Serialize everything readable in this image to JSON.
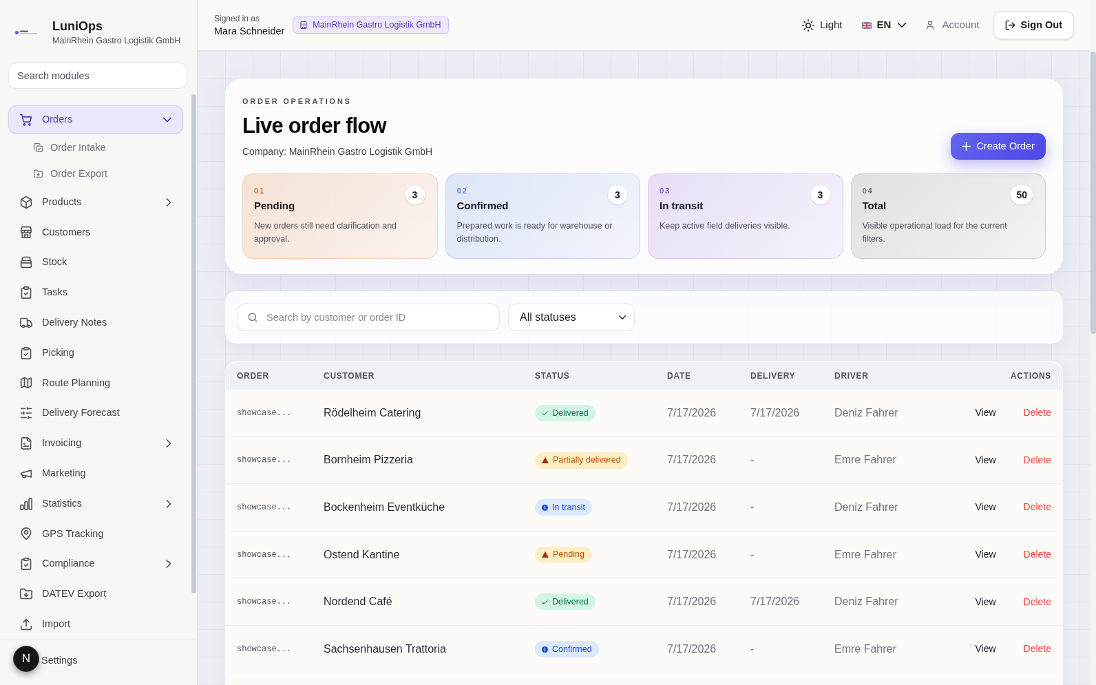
{
  "sidebar": {
    "brand": "LuniOps",
    "company": "MainRhein Gastro Logistik GmbH",
    "search": {
      "placeholder": "Search modules"
    },
    "items": [
      {
        "label": "Orders",
        "kind": "group",
        "selected": true,
        "expanded": true,
        "children": [
          {
            "label": "Order Intake",
            "selected": false
          },
          {
            "label": "Order Export",
            "selected": false
          }
        ]
      },
      {
        "label": "Products",
        "kind": "group",
        "selected": false,
        "expanded": false
      },
      {
        "label": "Customers",
        "kind": "link",
        "selected": false
      },
      {
        "label": "Stock",
        "kind": "link",
        "selected": false
      },
      {
        "label": "Tasks",
        "kind": "link",
        "selected": false
      },
      {
        "label": "Delivery Notes",
        "kind": "link",
        "selected": false
      },
      {
        "label": "Picking",
        "kind": "link",
        "selected": false
      },
      {
        "label": "Route Planning",
        "kind": "link",
        "selected": false
      },
      {
        "label": "Delivery Forecast",
        "kind": "link",
        "selected": false
      },
      {
        "label": "Invoicing",
        "kind": "group",
        "selected": false,
        "expanded": false
      },
      {
        "label": "Marketing",
        "kind": "link",
        "selected": false
      },
      {
        "label": "Statistics",
        "kind": "group",
        "selected": false,
        "expanded": false
      },
      {
        "label": "GPS Tracking",
        "kind": "link",
        "selected": false
      },
      {
        "label": "Compliance",
        "kind": "group",
        "selected": false,
        "expanded": false
      },
      {
        "label": "DATEV Export",
        "kind": "link",
        "selected": false
      },
      {
        "label": "Import",
        "kind": "link",
        "selected": false
      }
    ],
    "footer_item": {
      "label": "Settings"
    },
    "dev_indicator": "N"
  },
  "header": {
    "signed_in_label": "Signed in as",
    "user_name": "Mara Schneider",
    "company_badge": "MainRhein Gastro Logistik GmbH",
    "theme": "Light",
    "language": "EN",
    "account": "Account",
    "sign_out": "Sign Out"
  },
  "hero": {
    "eyebrow": "ORDER OPERATIONS",
    "title": "Live order flow",
    "company": "Company: MainRhein Gastro Logistik GmbH",
    "create_button": "Create Order",
    "stats": [
      {
        "index": "01",
        "title": "Pending",
        "count": "3",
        "description": "New orders still need clarification and approval.",
        "color": "#d9762a"
      },
      {
        "index": "02",
        "title": "Confirmed",
        "count": "3",
        "description": "Prepared work is ready for warehouse or distribution.",
        "color": "#5f86e0"
      },
      {
        "index": "03",
        "title": "In transit",
        "count": "3",
        "description": "Keep active field deliveries visible.",
        "color": "#9461d9"
      },
      {
        "index": "04",
        "title": "Total",
        "count": "50",
        "description": "Visible operational load for the current filters.",
        "color": "#6b6f76"
      }
    ]
  },
  "filters": {
    "search": {
      "placeholder": "Search by customer or order ID"
    },
    "status_select": {
      "value": "All statuses"
    }
  },
  "table": {
    "columns": [
      "ORDER",
      "CUSTOMER",
      "STATUS",
      "DATE",
      "DELIVERY",
      "DRIVER",
      "ACTIONS"
    ],
    "rows": [
      {
        "order": "showcase...",
        "customer": "Rödelheim Catering",
        "status": {
          "label": "Delivered",
          "kind": "success"
        },
        "date": "7/17/2026",
        "delivery": "7/17/2026",
        "driver": "Deniz Fahrer",
        "actions": [
          {
            "label": "View",
            "kind": "default"
          },
          {
            "label": "Delete",
            "kind": "danger"
          }
        ]
      },
      {
        "order": "showcase...",
        "customer": "Bornheim Pizzeria",
        "status": {
          "label": "Partially delivered",
          "kind": "warning"
        },
        "date": "7/17/2026",
        "delivery": "-",
        "driver": "Emre Fahrer",
        "actions": [
          {
            "label": "View",
            "kind": "default"
          },
          {
            "label": "Delete",
            "kind": "danger"
          }
        ]
      },
      {
        "order": "showcase...",
        "customer": "Bockenheim Eventküche",
        "status": {
          "label": "In transit",
          "kind": "info"
        },
        "date": "7/17/2026",
        "delivery": "-",
        "driver": "Deniz Fahrer",
        "actions": [
          {
            "label": "View",
            "kind": "default"
          },
          {
            "label": "Delete",
            "kind": "danger"
          }
        ]
      },
      {
        "order": "showcase...",
        "customer": "Ostend Kantine",
        "status": {
          "label": "Pending",
          "kind": "warning"
        },
        "date": "7/17/2026",
        "delivery": "-",
        "driver": "Emre Fahrer",
        "actions": [
          {
            "label": "View",
            "kind": "default"
          },
          {
            "label": "Delete",
            "kind": "danger"
          }
        ]
      },
      {
        "order": "showcase...",
        "customer": "Nordend Café",
        "status": {
          "label": "Delivered",
          "kind": "success"
        },
        "date": "7/17/2026",
        "delivery": "7/17/2026",
        "driver": "Deniz Fahrer",
        "actions": [
          {
            "label": "View",
            "kind": "default"
          },
          {
            "label": "Delete",
            "kind": "danger"
          }
        ]
      },
      {
        "order": "showcase...",
        "customer": "Sachsenhausen Trattoria",
        "status": {
          "label": "Confirmed",
          "kind": "info"
        },
        "date": "7/17/2026",
        "delivery": "-",
        "driver": "Emre Fahrer",
        "actions": [
          {
            "label": "View",
            "kind": "default"
          },
          {
            "label": "Delete",
            "kind": "danger"
          }
        ]
      }
    ]
  }
}
